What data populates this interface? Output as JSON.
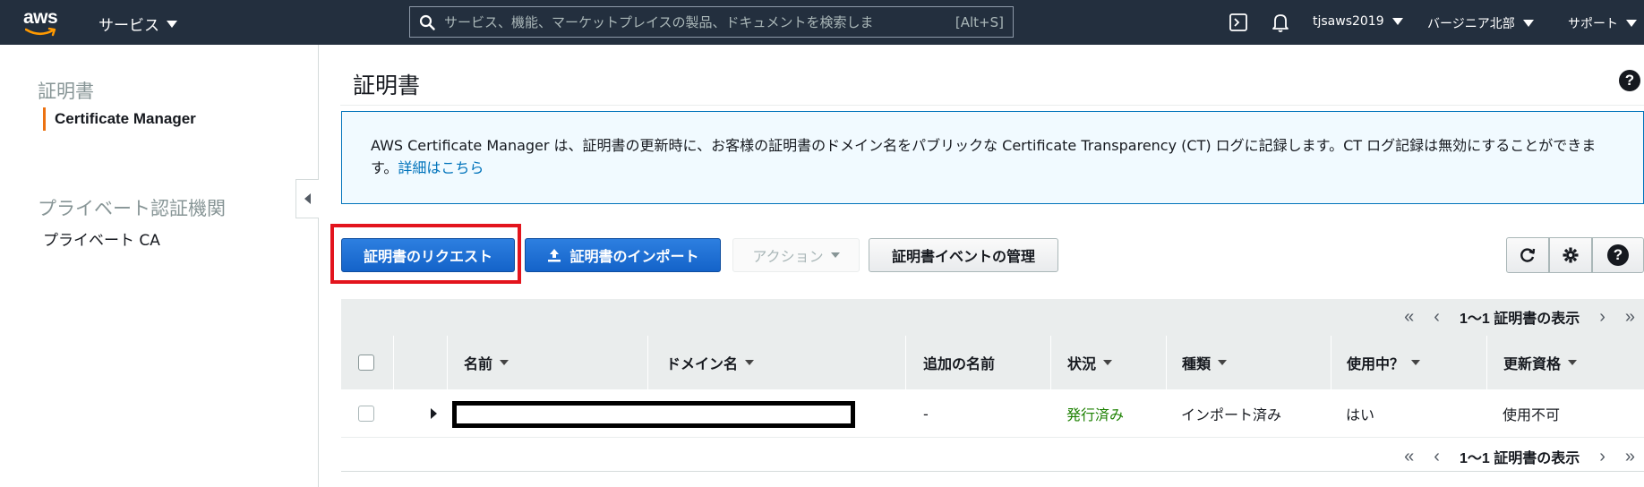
{
  "topnav": {
    "logo_text": "aws",
    "services_label": "サービス",
    "search_placeholder": "サービス、機能、マーケットプレイスの製品、ドキュメントを検索しま",
    "search_shortcut": "[Alt+S]",
    "user_label": "tjsaws2019",
    "region_label": "バージニア北部",
    "support_label": "サポート",
    "colors": {
      "background": "#232f3e",
      "logo_smile": "#ff9900"
    }
  },
  "sidebar": {
    "section1_title": "証明書",
    "section1_active_item": "Certificate Manager",
    "section2_title": "プライベート認証機関",
    "section2_item": "プライベート CA",
    "colors": {
      "active_marker": "#ec7211"
    }
  },
  "main": {
    "title": "証明書",
    "info_text": "AWS Certificate Manager は、証明書の更新時に、お客様の証明書のドメイン名をパブリックな Certificate Transparency (CT) ログに記録します。CT ログ記録は無効にすることができます。",
    "info_link": "詳細はこちら",
    "buttons": {
      "request": "証明書のリクエスト",
      "import": "証明書のインポート",
      "actions": "アクション",
      "manage_events": "証明書イベントの管理"
    },
    "colors": {
      "primary_button": "#1a6cdc",
      "highlight": "#e3141d",
      "info_border": "#0073bb"
    }
  },
  "table": {
    "pager_label": "1〜1 証明書の表示",
    "pager_first": "«",
    "pager_prev": "‹",
    "pager_next": "›",
    "pager_last": "»",
    "columns": {
      "name": "名前",
      "domain": "ドメイン名",
      "additional": "追加の名前",
      "status": "状況",
      "type": "種類",
      "in_use": "使用中？",
      "renewal": "更新資格"
    },
    "rows": [
      {
        "name": "",
        "domain": "",
        "additional": "-",
        "status": "発行済み",
        "type": "インポート済み",
        "in_use": "はい",
        "renewal": "使用不可"
      }
    ],
    "colors": {
      "status_issued": "#1d8102"
    }
  }
}
